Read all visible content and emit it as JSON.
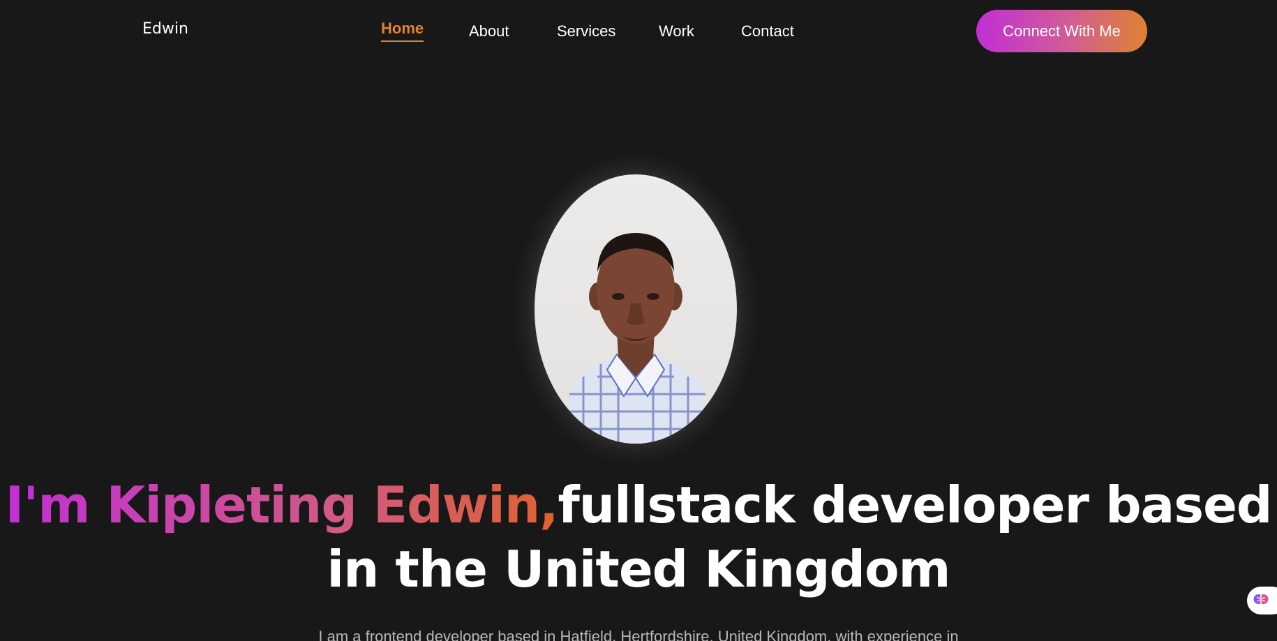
{
  "nav": {
    "logo": "Edwin",
    "items": [
      {
        "label": "Home",
        "active": true
      },
      {
        "label": "About"
      },
      {
        "label": "Services"
      },
      {
        "label": "Work"
      },
      {
        "label": "Contact"
      }
    ],
    "cta_label": "Connect With Me"
  },
  "hero": {
    "image_alt": "Portrait photo",
    "headline_highlight": "I'm Kipleting Edwin,",
    "headline_rest": "fullstack developer based in the United Kingdom",
    "intro": "I am a frontend developer based in Hatfield, Hertfordshire, United Kingdom, with experience in"
  },
  "colors": {
    "background": "#191818",
    "accent_orange": "#e0822f",
    "accent_purple": "#c22fd6"
  },
  "icons": {
    "widget": "brain-icon"
  }
}
